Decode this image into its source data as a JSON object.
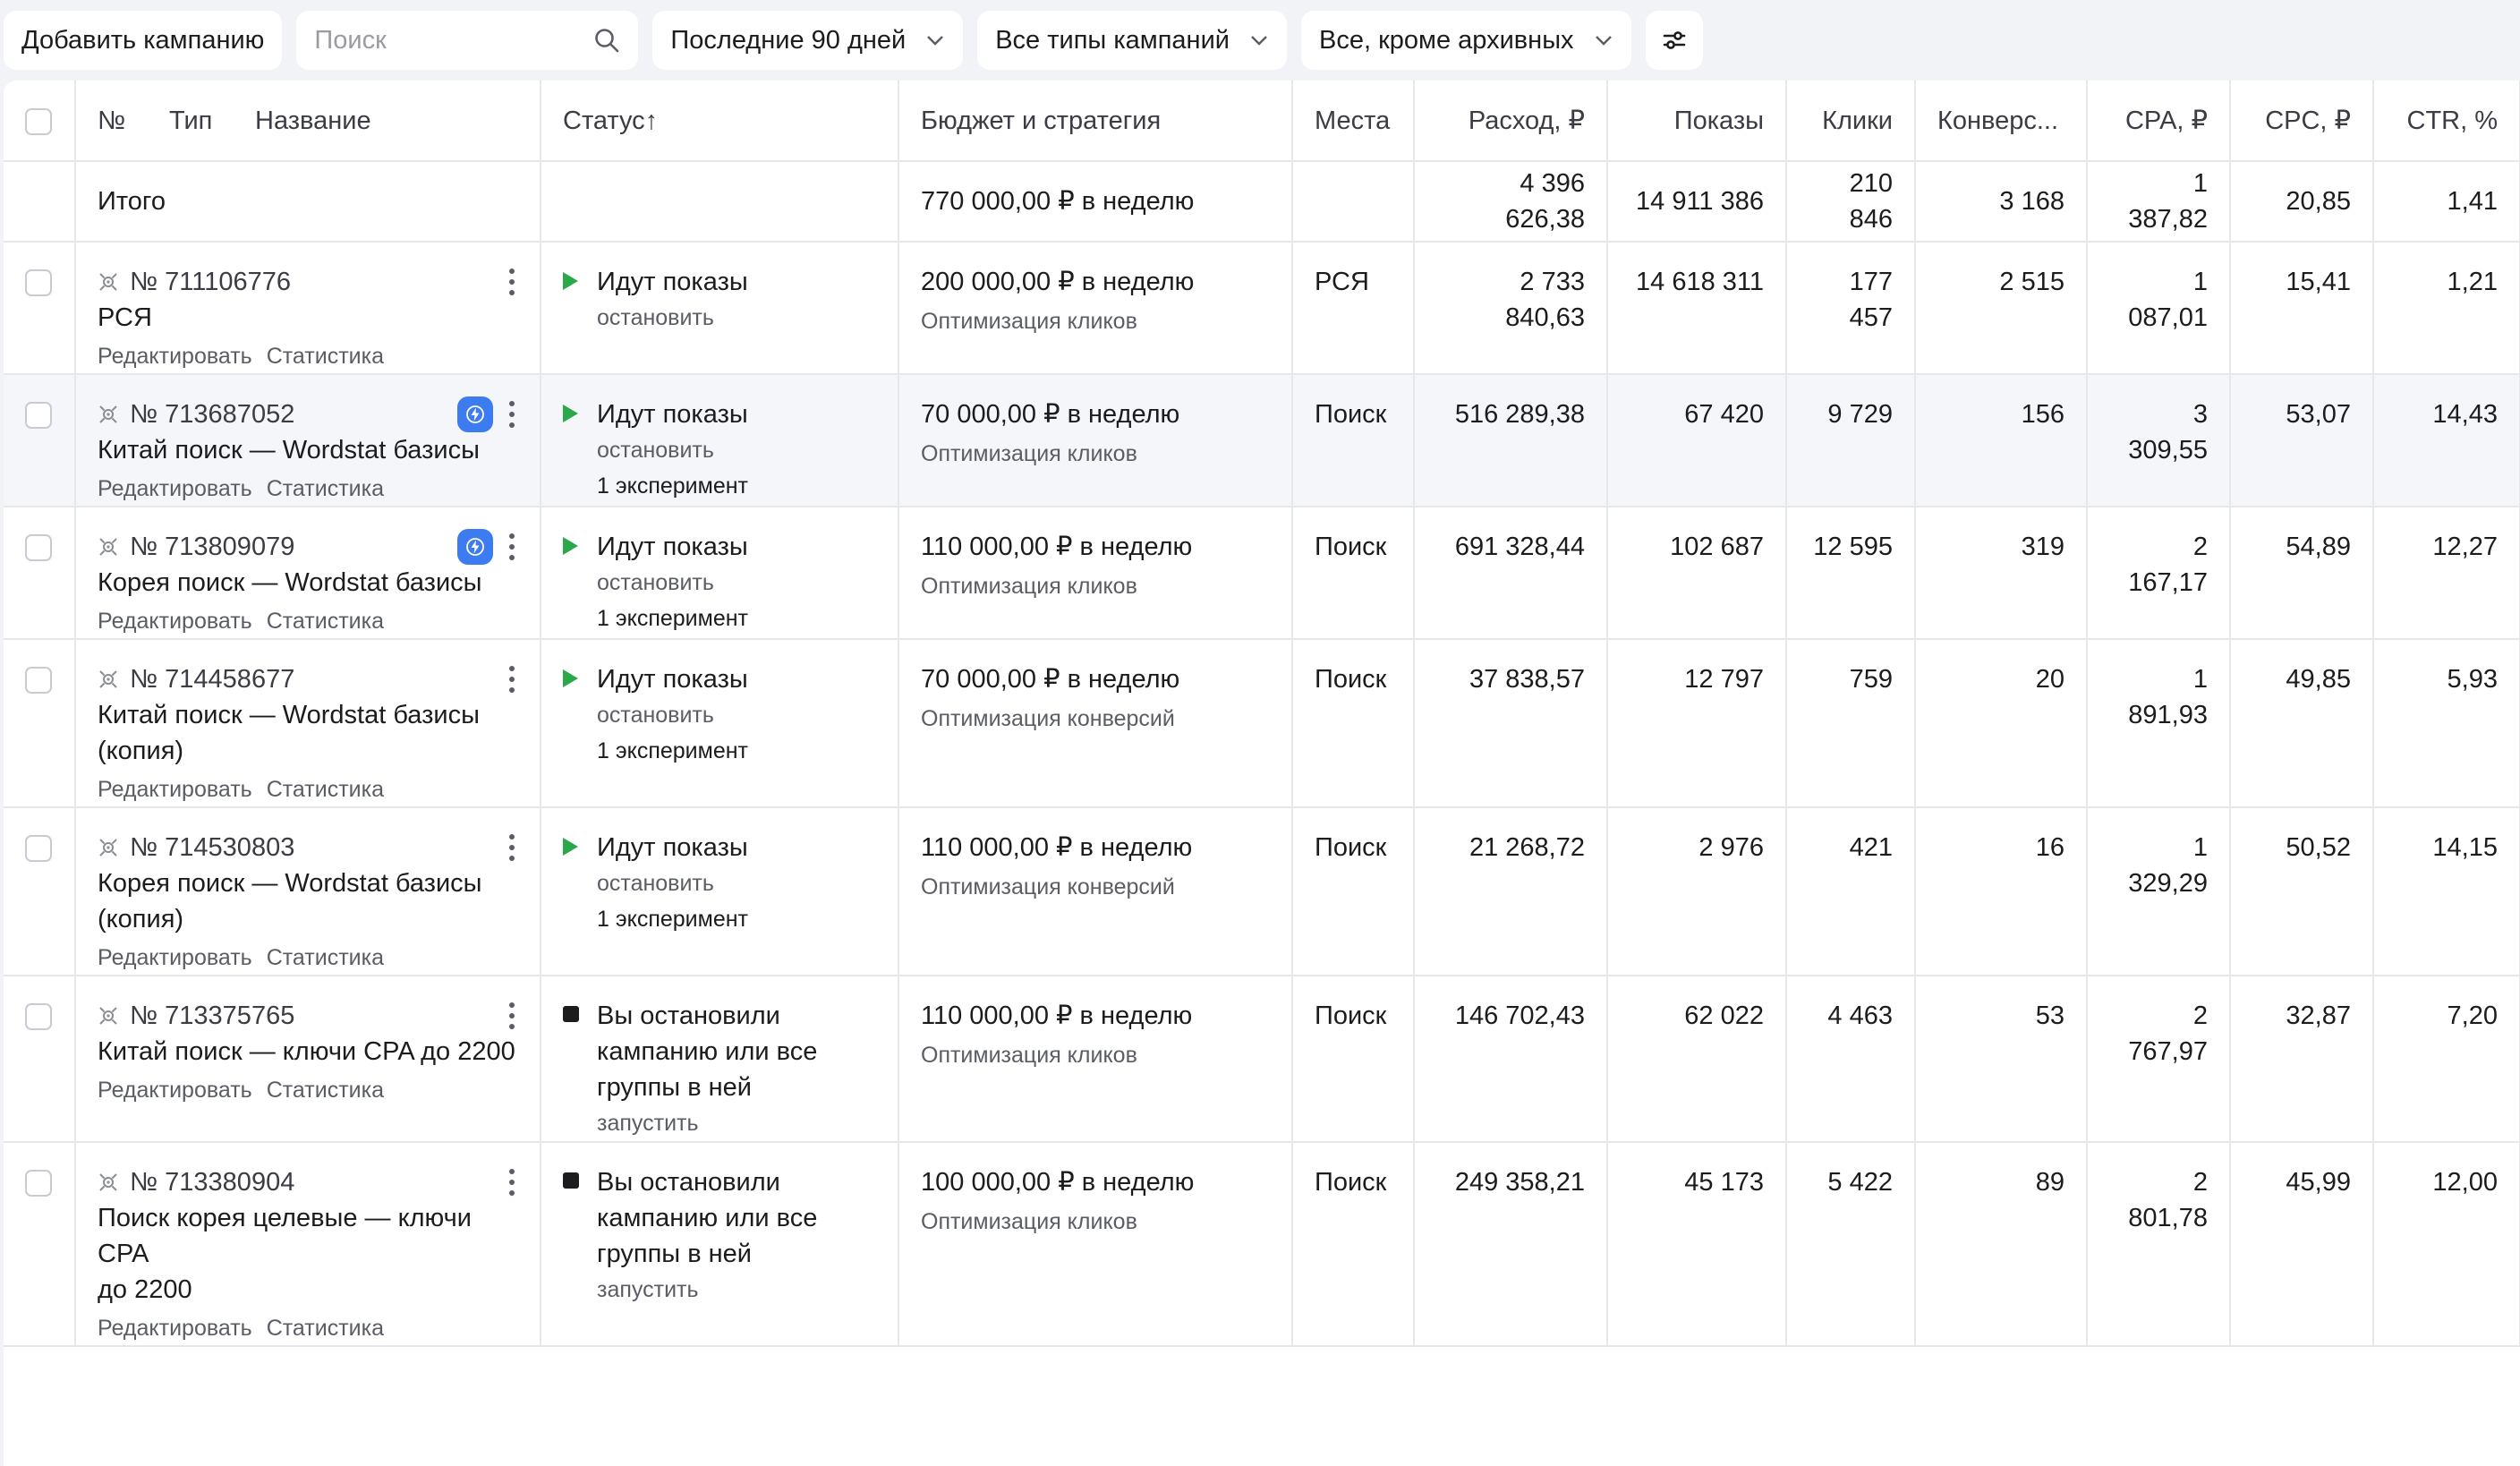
{
  "toolbar": {
    "add_campaign": "Добавить кампанию",
    "search_placeholder": "Поиск",
    "period": "Последние 90 дней",
    "campaign_types": "Все типы кампаний",
    "archive_filter": "Все, кроме архивных"
  },
  "headers": {
    "no": "№",
    "type": "Тип",
    "name": "Название",
    "status": "Статус",
    "status_sort": "↑",
    "budget": "Бюджет и стратегия",
    "places": "Места",
    "spend": "Расход, ₽",
    "impressions": "Показы",
    "clicks": "Клики",
    "conversions": "Конверс...",
    "cpa": "CPA, ₽",
    "cpc": "CPC, ₽",
    "ctr": "CTR, %"
  },
  "total": {
    "label": "Итого",
    "budget": "770 000,00 ₽ в неделю",
    "spend": "4 396 626,38",
    "impressions": "14 911 386",
    "clicks": "210 846",
    "conversions": "3 168",
    "cpa": "1 387,82",
    "cpc": "20,85",
    "ctr": "1,41"
  },
  "row_links": {
    "edit": "Редактировать",
    "stats": "Статистика"
  },
  "rows": [
    {
      "id": "№ 711106776",
      "name_lines": [
        "РСЯ"
      ],
      "bolt": false,
      "status": [
        "Идут показы"
      ],
      "status_kind": "running",
      "status_action": "остановить",
      "experiment": "",
      "budget": "200 000,00 ₽ в неделю",
      "strategy": "Оптимизация кликов",
      "places": "РСЯ",
      "spend": "2 733 840,63",
      "impressions": "14 618 311",
      "clicks": "177 457",
      "conversions": "2 515",
      "cpa": "1 087,01",
      "cpc": "15,41",
      "ctr": "1,21"
    },
    {
      "id": "№ 713687052",
      "name_lines": [
        "Китай поиск — Wordstat базисы"
      ],
      "bolt": true,
      "status": [
        "Идут показы"
      ],
      "status_kind": "running",
      "status_action": "остановить",
      "experiment": "1 эксперимент",
      "budget": "70 000,00 ₽ в неделю",
      "strategy": "Оптимизация кликов",
      "places": "Поиск",
      "spend": "516 289,38",
      "impressions": "67 420",
      "clicks": "9 729",
      "conversions": "156",
      "cpa": "3 309,55",
      "cpc": "53,07",
      "ctr": "14,43"
    },
    {
      "id": "№ 713809079",
      "name_lines": [
        "Корея поиск — Wordstat базисы"
      ],
      "bolt": true,
      "status": [
        "Идут показы"
      ],
      "status_kind": "running",
      "status_action": "остановить",
      "experiment": "1 эксперимент",
      "budget": "110 000,00 ₽ в неделю",
      "strategy": "Оптимизация кликов",
      "places": "Поиск",
      "spend": "691 328,44",
      "impressions": "102 687",
      "clicks": "12 595",
      "conversions": "319",
      "cpa": "2 167,17",
      "cpc": "54,89",
      "ctr": "12,27"
    },
    {
      "id": "№ 714458677",
      "name_lines": [
        "Китай поиск — Wordstat базисы",
        "(копия)"
      ],
      "bolt": false,
      "status": [
        "Идут показы"
      ],
      "status_kind": "running",
      "status_action": "остановить",
      "experiment": "1 эксперимент",
      "budget": "70 000,00 ₽ в неделю",
      "strategy": "Оптимизация конверсий",
      "places": "Поиск",
      "spend": "37 838,57",
      "impressions": "12 797",
      "clicks": "759",
      "conversions": "20",
      "cpa": "1 891,93",
      "cpc": "49,85",
      "ctr": "5,93"
    },
    {
      "id": "№ 714530803",
      "name_lines": [
        "Корея поиск — Wordstat базисы",
        "(копия)"
      ],
      "bolt": false,
      "status": [
        "Идут показы"
      ],
      "status_kind": "running",
      "status_action": "остановить",
      "experiment": "1 эксперимент",
      "budget": "110 000,00 ₽ в неделю",
      "strategy": "Оптимизация конверсий",
      "places": "Поиск",
      "spend": "21 268,72",
      "impressions": "2 976",
      "clicks": "421",
      "conversions": "16",
      "cpa": "1 329,29",
      "cpc": "50,52",
      "ctr": "14,15"
    },
    {
      "id": "№ 713375765",
      "name_lines": [
        "Китай поиск — ключи CPA до 2200"
      ],
      "bolt": false,
      "status": [
        "Вы остановили",
        "кампанию или все",
        "группы в ней"
      ],
      "status_kind": "stopped",
      "status_action": "запустить",
      "experiment": "",
      "budget": "110 000,00 ₽ в неделю",
      "strategy": "Оптимизация кликов",
      "places": "Поиск",
      "spend": "146 702,43",
      "impressions": "62 022",
      "clicks": "4 463",
      "conversions": "53",
      "cpa": "2 767,97",
      "cpc": "32,87",
      "ctr": "7,20"
    },
    {
      "id": "№ 713380904",
      "name_lines": [
        "Поиск корея целевые — ключи CPA",
        "до 2200"
      ],
      "bolt": false,
      "status": [
        "Вы остановили",
        "кампанию или все",
        "группы в ней"
      ],
      "status_kind": "stopped",
      "status_action": "запустить",
      "experiment": "",
      "budget": "100 000,00 ₽ в неделю",
      "strategy": "Оптимизация кликов",
      "places": "Поиск",
      "spend": "249 358,21",
      "impressions": "45 173",
      "clicks": "5 422",
      "conversions": "89",
      "cpa": "2 801,78",
      "cpc": "45,99",
      "ctr": "12,00"
    }
  ],
  "colors": {
    "running": "#2ba84a",
    "stopped": "#1c1c1e",
    "accent": "#3d7bf0",
    "highlight_row": "#f5f6fa"
  },
  "icons": {
    "search": "search-icon",
    "chevron": "chevron-down-icon",
    "settings": "sliders-icon",
    "campaign_type": "target-icon",
    "bolt": "lightning-icon",
    "more": "kebab-icon"
  },
  "highlighted_row": 1
}
